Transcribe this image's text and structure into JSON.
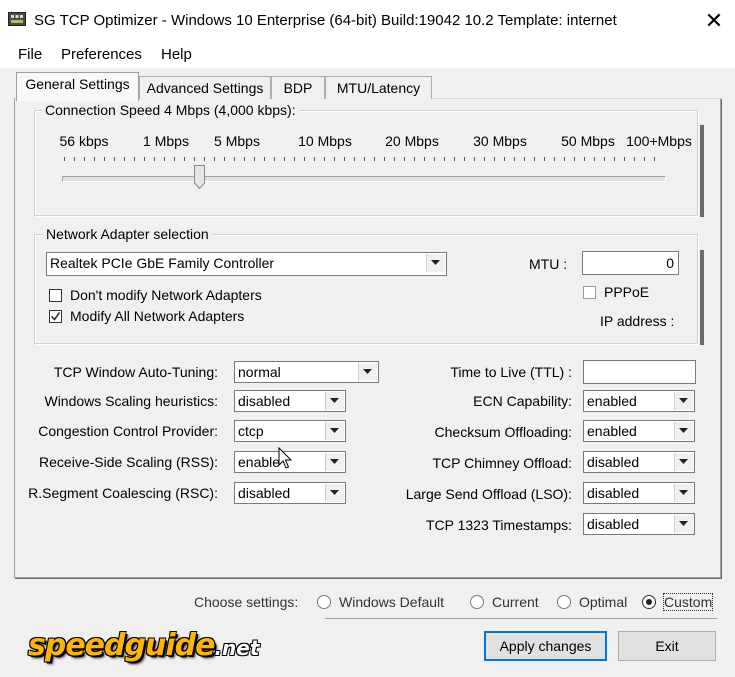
{
  "window": {
    "title": "SG TCP Optimizer - Windows 10 Enterprise (64-bit) Build:19042 10.2  Template: internet",
    "close_symbol": "✕"
  },
  "menu": [
    "File",
    "Preferences",
    "Help"
  ],
  "tabs": [
    "General Settings",
    "Advanced Settings",
    "BDP",
    "MTU/Latency"
  ],
  "connection_speed": {
    "label": "Connection Speed  4 Mbps (4,000 kbps):",
    "ticks": [
      "56 kbps",
      "1 Mbps",
      "5 Mbps",
      "10 Mbps",
      "20 Mbps",
      "30 Mbps",
      "50 Mbps",
      "100+Mbps"
    ]
  },
  "adapter": {
    "group_label": "Network Adapter selection",
    "selected": "Realtek PCIe GbE Family Controller",
    "mtu_label": "MTU :",
    "mtu_value": "0",
    "pppoe_label": "PPPoE",
    "dont_modify_label": "Don't modify Network Adapters",
    "modify_all_label": "Modify All Network Adapters",
    "ip_label": "IP address :"
  },
  "left_settings": [
    {
      "label": "TCP Window Auto-Tuning:",
      "value": "normal"
    },
    {
      "label": "Windows Scaling heuristics:",
      "value": "disabled"
    },
    {
      "label": "Congestion Control Provider:",
      "value": "ctcp"
    },
    {
      "label": "Receive-Side Scaling (RSS):",
      "value": "enable"
    },
    {
      "label": "R.Segment Coalescing (RSC):",
      "value": "disabled"
    }
  ],
  "right_settings": {
    "ttl_label": "Time to Live (TTL) :",
    "ttl_value": "",
    "items": [
      {
        "label": "ECN Capability:",
        "value": "enabled"
      },
      {
        "label": "Checksum Offloading:",
        "value": "enabled"
      },
      {
        "label": "TCP Chimney Offload:",
        "value": "disabled"
      },
      {
        "label": "Large Send Offload (LSO):",
        "value": "disabled"
      },
      {
        "label": "TCP 1323 Timestamps:",
        "value": "disabled"
      }
    ]
  },
  "choose": {
    "label": "Choose settings:",
    "options": [
      "Windows Default",
      "Current",
      "Optimal",
      "Custom"
    ],
    "selected": "Custom"
  },
  "buttons": {
    "apply": "Apply changes",
    "exit": "Exit"
  },
  "logo": {
    "main": "speedguide",
    "suffix": ".net"
  }
}
